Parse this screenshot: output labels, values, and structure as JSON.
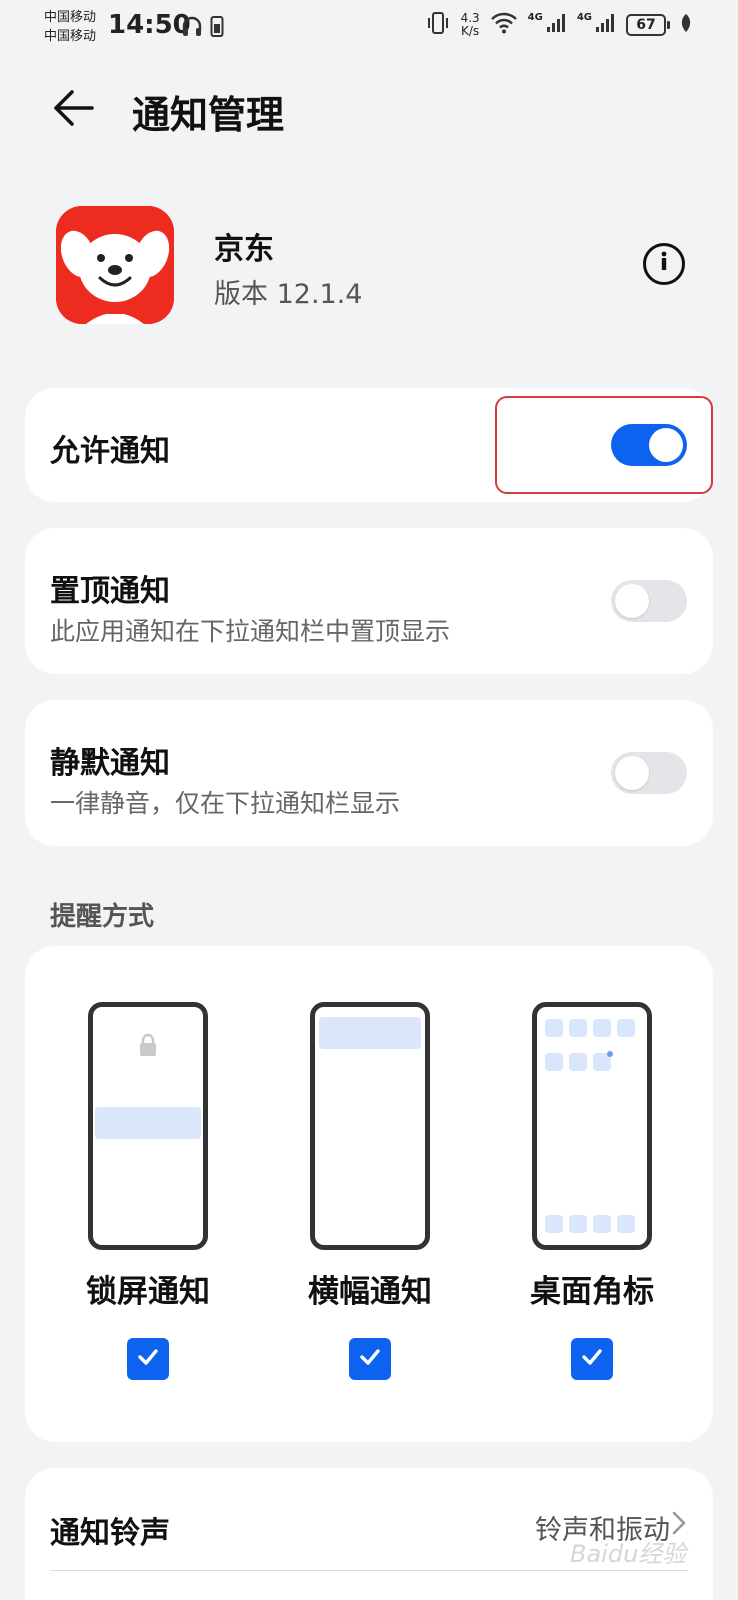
{
  "status_bar": {
    "carrier_1": "中国移动",
    "carrier_2": "中国移动",
    "time": "14:50",
    "speed_value": "4.3",
    "speed_unit": "K/s",
    "net_1": "4G",
    "net_2": "4G",
    "battery": "67"
  },
  "header": {
    "title": "通知管理"
  },
  "app": {
    "name": "京东",
    "version_label": "版本",
    "version": "12.1.4",
    "icon": "jd-dog-logo",
    "icon_color": "#ee2b1f"
  },
  "settings": {
    "allow": {
      "label": "允许通知",
      "enabled": true
    },
    "pinned": {
      "label": "置顶通知",
      "description": "此应用通知在下拉通知栏中置顶显示",
      "enabled": false
    },
    "silent": {
      "label": "静默通知",
      "description": "一律静音，仅在下拉通知栏显示",
      "enabled": false
    }
  },
  "reminder": {
    "section_label": "提醒方式",
    "options": [
      {
        "label": "锁屏通知",
        "checked": true
      },
      {
        "label": "横幅通知",
        "checked": true
      },
      {
        "label": "桌面角标",
        "checked": true
      }
    ]
  },
  "ringtone": {
    "label": "通知铃声",
    "value": "铃声和振动"
  },
  "watermark": "Baidu经验",
  "colors": {
    "accent": "#0d63f0",
    "highlight_border": "#d23c3c",
    "background": "#f1f3f5"
  }
}
